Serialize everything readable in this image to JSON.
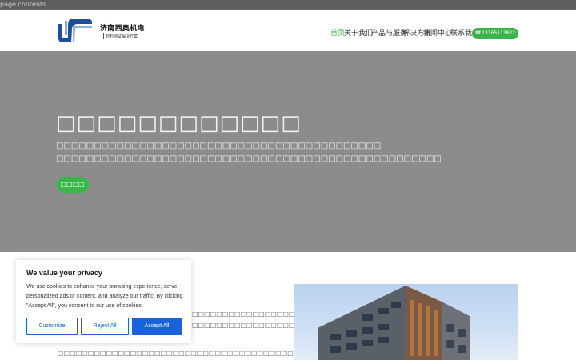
{
  "top_strip": {
    "text": "page contents"
  },
  "brand": {
    "name": "济南西奥机电",
    "tagline": "材料测试解决方案"
  },
  "nav": {
    "items": [
      {
        "label": "首页",
        "active": true,
        "dropdown": false
      },
      {
        "label": "关于我们",
        "active": false,
        "dropdown": true
      },
      {
        "label": "产品与服务",
        "active": false,
        "dropdown": true
      },
      {
        "label": "解决方案",
        "active": false,
        "dropdown": false
      },
      {
        "label": "新闻中心",
        "active": false,
        "dropdown": true
      },
      {
        "label": "联系我们",
        "active": false,
        "dropdown": false
      }
    ],
    "phone": "13165113822",
    "phone_icon": "phone-icon"
  },
  "hero": {
    "title": "□□□□□□□□□□□□",
    "line1": "□□□□□□□□□□□□□□□□□□□□□□□□□□□□□□□□□□□□□□□□□□□",
    "line2": "□□□□□□□□□□□□□□□□□□□□□□□□□□□□□□□□□□□□□□□□□□□□□□□□□□□",
    "button": "□□□□",
    "background": "#8c8c8c"
  },
  "content": {
    "para1_line1": "□□□□□□□□□□□□□□□□□□□□□□□□□□□□□□□□□□□",
    "para1_line2": "□□□□□□□□□□□□□□□□□□□□□□□□□□□□□□□□□□□",
    "para2_line1": "□□□□□□□□□□□□□□□□□□□□□□□□□□□□□□□□□□□□□□□□□□□□□□□□□□□□□□□□□□□□□□□□"
  },
  "cookie": {
    "title": "We value your privacy",
    "text": "We use cookies to enhance your browsing experience, serve personalized ads or content, and analyze our traffic. By clicking \"Accept All\", you consent to our use of cookies.",
    "customize": "Customize",
    "reject": "Reject All",
    "accept": "Accept All"
  },
  "colors": {
    "accent_green": "#3ab54a",
    "cookie_blue": "#1863dc"
  }
}
